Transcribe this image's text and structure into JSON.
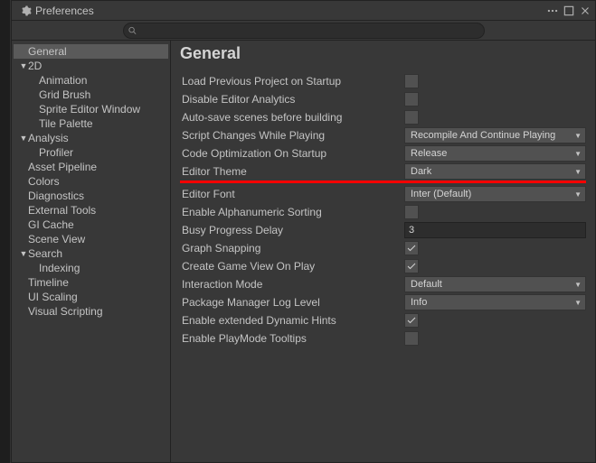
{
  "window": {
    "title": "Preferences"
  },
  "search": {
    "placeholder": ""
  },
  "sidebar": {
    "items": [
      {
        "label": "General",
        "expand": "",
        "indent": 0,
        "selected": true
      },
      {
        "label": "2D",
        "expand": "▼",
        "indent": 0
      },
      {
        "label": "Animation",
        "expand": "",
        "indent": 1
      },
      {
        "label": "Grid Brush",
        "expand": "",
        "indent": 1
      },
      {
        "label": "Sprite Editor Window",
        "expand": "",
        "indent": 1
      },
      {
        "label": "Tile Palette",
        "expand": "",
        "indent": 1
      },
      {
        "label": "Analysis",
        "expand": "▼",
        "indent": 0
      },
      {
        "label": "Profiler",
        "expand": "",
        "indent": 1
      },
      {
        "label": "Asset Pipeline",
        "expand": "",
        "indent": 0
      },
      {
        "label": "Colors",
        "expand": "",
        "indent": 0
      },
      {
        "label": "Diagnostics",
        "expand": "",
        "indent": 0
      },
      {
        "label": "External Tools",
        "expand": "",
        "indent": 0
      },
      {
        "label": "GI Cache",
        "expand": "",
        "indent": 0
      },
      {
        "label": "Scene View",
        "expand": "",
        "indent": 0
      },
      {
        "label": "Search",
        "expand": "▼",
        "indent": 0
      },
      {
        "label": "Indexing",
        "expand": "",
        "indent": 1
      },
      {
        "label": "Timeline",
        "expand": "",
        "indent": 0
      },
      {
        "label": "UI Scaling",
        "expand": "",
        "indent": 0
      },
      {
        "label": "Visual Scripting",
        "expand": "",
        "indent": 0
      }
    ]
  },
  "page": {
    "heading": "General",
    "fields": {
      "load_previous": {
        "label": "Load Previous Project on Startup",
        "type": "checkbox",
        "value": false
      },
      "disable_analytics": {
        "label": "Disable Editor Analytics",
        "type": "checkbox",
        "value": false
      },
      "autosave": {
        "label": "Auto-save scenes before building",
        "type": "checkbox",
        "value": false
      },
      "script_changes": {
        "label": "Script Changes While Playing",
        "type": "dropdown",
        "value": "Recompile And Continue Playing"
      },
      "code_opt": {
        "label": "Code Optimization On Startup",
        "type": "dropdown",
        "value": "Release"
      },
      "editor_theme": {
        "label": "Editor Theme",
        "type": "dropdown",
        "value": "Dark"
      },
      "editor_font": {
        "label": "Editor Font",
        "type": "dropdown",
        "value": "Inter (Default)"
      },
      "alpha_sort": {
        "label": "Enable Alphanumeric Sorting",
        "type": "checkbox",
        "value": false
      },
      "busy_delay": {
        "label": "Busy Progress Delay",
        "type": "text",
        "value": "3"
      },
      "graph_snap": {
        "label": "Graph Snapping",
        "type": "checkbox",
        "value": true
      },
      "game_view": {
        "label": "Create Game View On Play",
        "type": "checkbox",
        "value": true
      },
      "interaction_mode": {
        "label": "Interaction Mode",
        "type": "dropdown",
        "value": "Default"
      },
      "pkg_log": {
        "label": "Package Manager Log Level",
        "type": "dropdown",
        "value": "Info"
      },
      "dyn_hints": {
        "label": "Enable extended Dynamic Hints",
        "type": "checkbox",
        "value": true
      },
      "playmode_tt": {
        "label": "Enable PlayMode Tooltips",
        "type": "checkbox",
        "value": false
      }
    },
    "field_order": [
      "load_previous",
      "disable_analytics",
      "autosave",
      "script_changes",
      "code_opt",
      "editor_theme",
      "__red__",
      "editor_font",
      "alpha_sort",
      "busy_delay",
      "graph_snap",
      "game_view",
      "interaction_mode",
      "pkg_log",
      "dyn_hints",
      "playmode_tt"
    ]
  }
}
